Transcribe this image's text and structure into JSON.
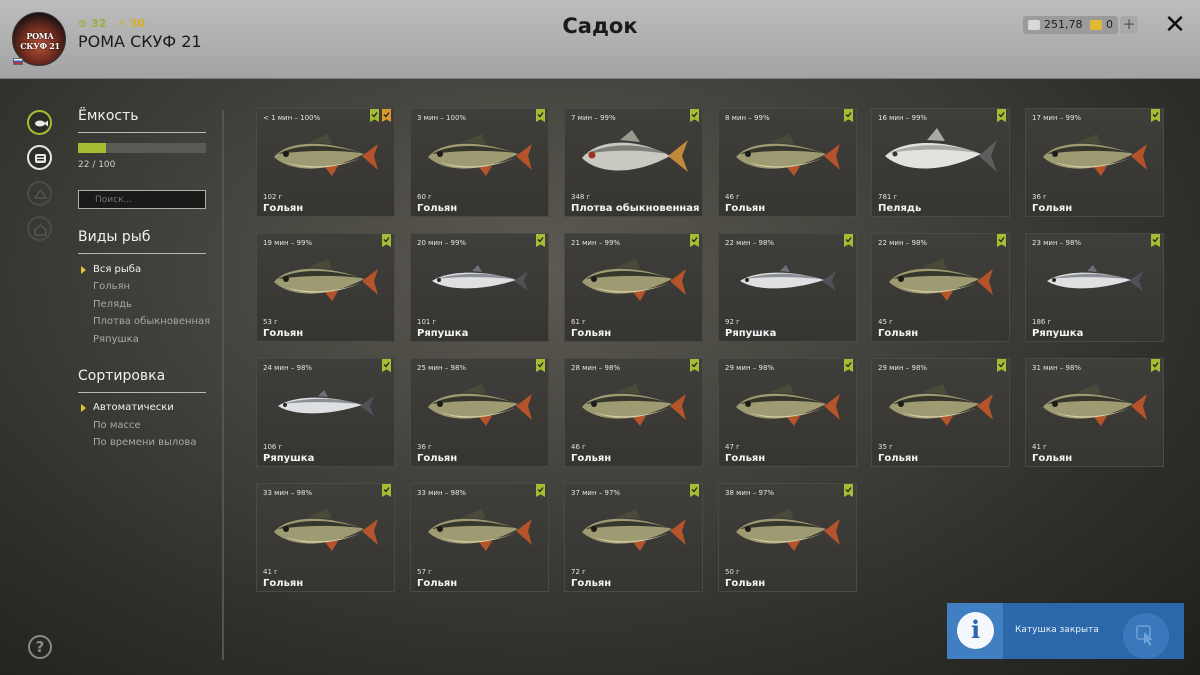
{
  "header": {
    "title": "Садок",
    "username": "РОМА СКУФ 21",
    "avatar_text": "РОМА СКУФ 21",
    "stat_green": "32",
    "stat_gold": "30",
    "currency_silver": "251,78",
    "currency_gold": "0",
    "plus_label": "+",
    "close_label": "✕"
  },
  "sidebar": {
    "capacity_title": "Ёмкость",
    "capacity_text": "22 / 100",
    "capacity_fraction": 0.22,
    "search_placeholder": "Поиск...",
    "species_title": "Виды рыб",
    "species": [
      "Вся рыба",
      "Гольян",
      "Пелядь",
      "Плотва обыкновенная",
      "Ряпушка"
    ],
    "sort_title": "Сортировка",
    "sort_options": [
      "Автоматически",
      "По массе",
      "По времени вылова"
    ],
    "help_label": "?"
  },
  "colors": {
    "accent": "#a6bd33",
    "selection_arrow": "#e0c33a",
    "notification": "#2b67a9"
  },
  "fish": [
    {
      "time": "< 1 мин – 100%",
      "weight": "102 г",
      "name": "Гольян",
      "kind": "minnow",
      "badges": [
        "green",
        "orange"
      ]
    },
    {
      "time": "3 мин – 100%",
      "weight": "60 г",
      "name": "Гольян",
      "kind": "minnow",
      "badges": [
        "green"
      ]
    },
    {
      "time": "7 мин – 99%",
      "weight": "348 г",
      "name": "Плотва обыкновенная",
      "kind": "roach",
      "badges": [
        "green"
      ]
    },
    {
      "time": "8 мин – 99%",
      "weight": "46 г",
      "name": "Гольян",
      "kind": "minnow",
      "badges": [
        "green"
      ]
    },
    {
      "time": "16 мин – 99%",
      "weight": "781 г",
      "name": "Пелядь",
      "kind": "whitefish",
      "badges": [
        "green"
      ]
    },
    {
      "time": "17 мин – 99%",
      "weight": "36 г",
      "name": "Гольян",
      "kind": "minnow",
      "badges": [
        "green"
      ]
    },
    {
      "time": "19 мин – 99%",
      "weight": "53 г",
      "name": "Гольян",
      "kind": "minnow",
      "badges": [
        "green"
      ]
    },
    {
      "time": "20 мин – 99%",
      "weight": "101 г",
      "name": "Ряпушка",
      "kind": "vendace",
      "badges": [
        "green"
      ]
    },
    {
      "time": "21 мин – 99%",
      "weight": "61 г",
      "name": "Гольян",
      "kind": "minnow",
      "badges": [
        "green"
      ]
    },
    {
      "time": "22 мин – 98%",
      "weight": "92 г",
      "name": "Ряпушка",
      "kind": "vendace",
      "badges": [
        "green"
      ]
    },
    {
      "time": "22 мин – 98%",
      "weight": "45 г",
      "name": "Гольян",
      "kind": "minnow",
      "badges": [
        "green"
      ]
    },
    {
      "time": "23 мин – 98%",
      "weight": "186 г",
      "name": "Ряпушка",
      "kind": "vendace",
      "badges": [
        "green"
      ]
    },
    {
      "time": "24 мин – 98%",
      "weight": "106 г",
      "name": "Ряпушка",
      "kind": "vendace",
      "badges": [
        "green"
      ]
    },
    {
      "time": "25 мин – 98%",
      "weight": "36 г",
      "name": "Гольян",
      "kind": "minnow",
      "badges": [
        "green"
      ]
    },
    {
      "time": "28 мин – 98%",
      "weight": "46 г",
      "name": "Гольян",
      "kind": "minnow",
      "badges": [
        "green"
      ]
    },
    {
      "time": "29 мин – 98%",
      "weight": "47 г",
      "name": "Гольян",
      "kind": "minnow",
      "badges": [
        "green"
      ]
    },
    {
      "time": "29 мин – 98%",
      "weight": "35 г",
      "name": "Гольян",
      "kind": "minnow",
      "badges": [
        "green"
      ]
    },
    {
      "time": "31 мин – 98%",
      "weight": "41 г",
      "name": "Гольян",
      "kind": "minnow",
      "badges": [
        "green"
      ]
    },
    {
      "time": "33 мин – 98%",
      "weight": "41 г",
      "name": "Гольян",
      "kind": "minnow",
      "badges": [
        "green"
      ]
    },
    {
      "time": "33 мин – 98%",
      "weight": "57 г",
      "name": "Гольян",
      "kind": "minnow",
      "badges": [
        "green"
      ]
    },
    {
      "time": "37 мин – 97%",
      "weight": "72 г",
      "name": "Гольян",
      "kind": "minnow",
      "badges": [
        "green"
      ]
    },
    {
      "time": "38 мин – 97%",
      "weight": "50 г",
      "name": "Гольян",
      "kind": "minnow",
      "badges": [
        "green"
      ]
    }
  ],
  "notification": {
    "text": "Катушка закрыта",
    "icon_label": "i"
  }
}
